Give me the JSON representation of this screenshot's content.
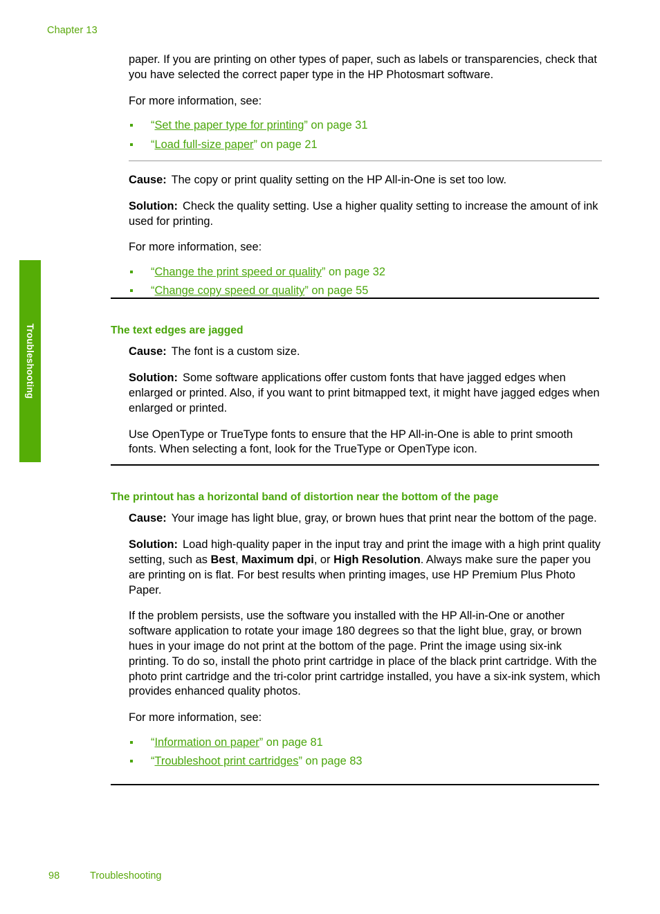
{
  "page": {
    "chapter_label": "Chapter 13",
    "side_tab_label": "Troubleshooting",
    "footer_page_number": "98",
    "footer_title": "Troubleshooting",
    "accent_green": "#4aa60b",
    "tab_green": "#55ad06",
    "header_green": "#5aa80c"
  },
  "intro": {
    "paragraph": "paper. If you are printing on other types of paper, such as labels or transparencies, check that you have selected the correct paper type in the HP Photosmart software.",
    "more_info_label": "For more information, see:",
    "links": [
      {
        "open_quote": "“",
        "text": "Set the paper type for printing",
        "suffix": "” on page 31"
      },
      {
        "open_quote": "“",
        "text": "Load full-size paper",
        "suffix": "” on page 21"
      }
    ]
  },
  "block_quality": {
    "cause_label": "Cause:",
    "cause_text": "The copy or print quality setting on the HP All-in-One is set too low.",
    "solution_label": "Solution:",
    "solution_text": "Check the quality setting. Use a higher quality setting to increase the amount of ink used for printing.",
    "more_info_label": "For more information, see:",
    "links": [
      {
        "open_quote": "“",
        "text": "Change the print speed or quality",
        "suffix": "” on page 32"
      },
      {
        "open_quote": "“",
        "text": "Change copy speed or quality",
        "suffix": "” on page 55"
      }
    ]
  },
  "section_jagged": {
    "heading": "The text edges are jagged",
    "cause_label": "Cause:",
    "cause_text": "The font is a custom size.",
    "solution_label": "Solution:",
    "solution_text": "Some software applications offer custom fonts that have jagged edges when enlarged or printed. Also, if you want to print bitmapped text, it might have jagged edges when enlarged or printed.",
    "extra_paragraph": "Use OpenType or TrueType fonts to ensure that the HP All-in-One is able to print smooth fonts. When selecting a font, look for the TrueType or OpenType icon."
  },
  "section_band": {
    "heading": "The printout has a horizontal band of distortion near the bottom of the page",
    "cause_label": "Cause:",
    "cause_text": "Your image has light blue, gray, or brown hues that print near the bottom of the page.",
    "solution_label": "Solution:",
    "solution_part1": "Load high-quality paper in the input tray and print the image with a high print quality setting, such as ",
    "solution_bold1": "Best",
    "solution_mid1": ", ",
    "solution_bold2": "Maximum dpi",
    "solution_mid2": ", or ",
    "solution_bold3": "High Resolution",
    "solution_part2": ". Always make sure the paper you are printing on is flat. For best results when printing images, use HP Premium Plus Photo Paper.",
    "persist_paragraph": "If the problem persists, use the software you installed with the HP All-in-One or another software application to rotate your image 180 degrees so that the light blue, gray, or brown hues in your image do not print at the bottom of the page. Print the image using six-ink printing. To do so, install the photo print cartridge in place of the black print cartridge. With the photo print cartridge and the tri-color print cartridge installed, you have a six-ink system, which provides enhanced quality photos.",
    "more_info_label": "For more information, see:",
    "links": [
      {
        "open_quote": "“",
        "text": "Information on paper",
        "suffix": "” on page 81"
      },
      {
        "open_quote": "“",
        "text": "Troubleshoot print cartridges",
        "suffix": "” on page 83"
      }
    ]
  }
}
